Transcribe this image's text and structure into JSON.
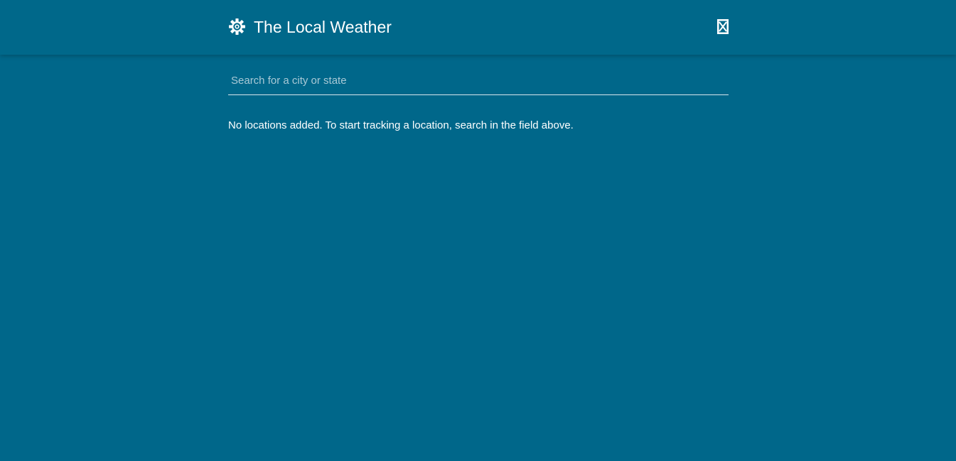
{
  "app": {
    "title": "The Local Weather",
    "background_color": "#00678a",
    "header_color": "#00688a",
    "text_color": "#ffffff"
  },
  "header": {
    "settings_icon": "gear-icon",
    "close_icon": "close-icon"
  },
  "search": {
    "placeholder": "Search for a city or state",
    "value": ""
  },
  "locations": {
    "empty_message": "No locations added. To start tracking a location, search in the field above."
  }
}
